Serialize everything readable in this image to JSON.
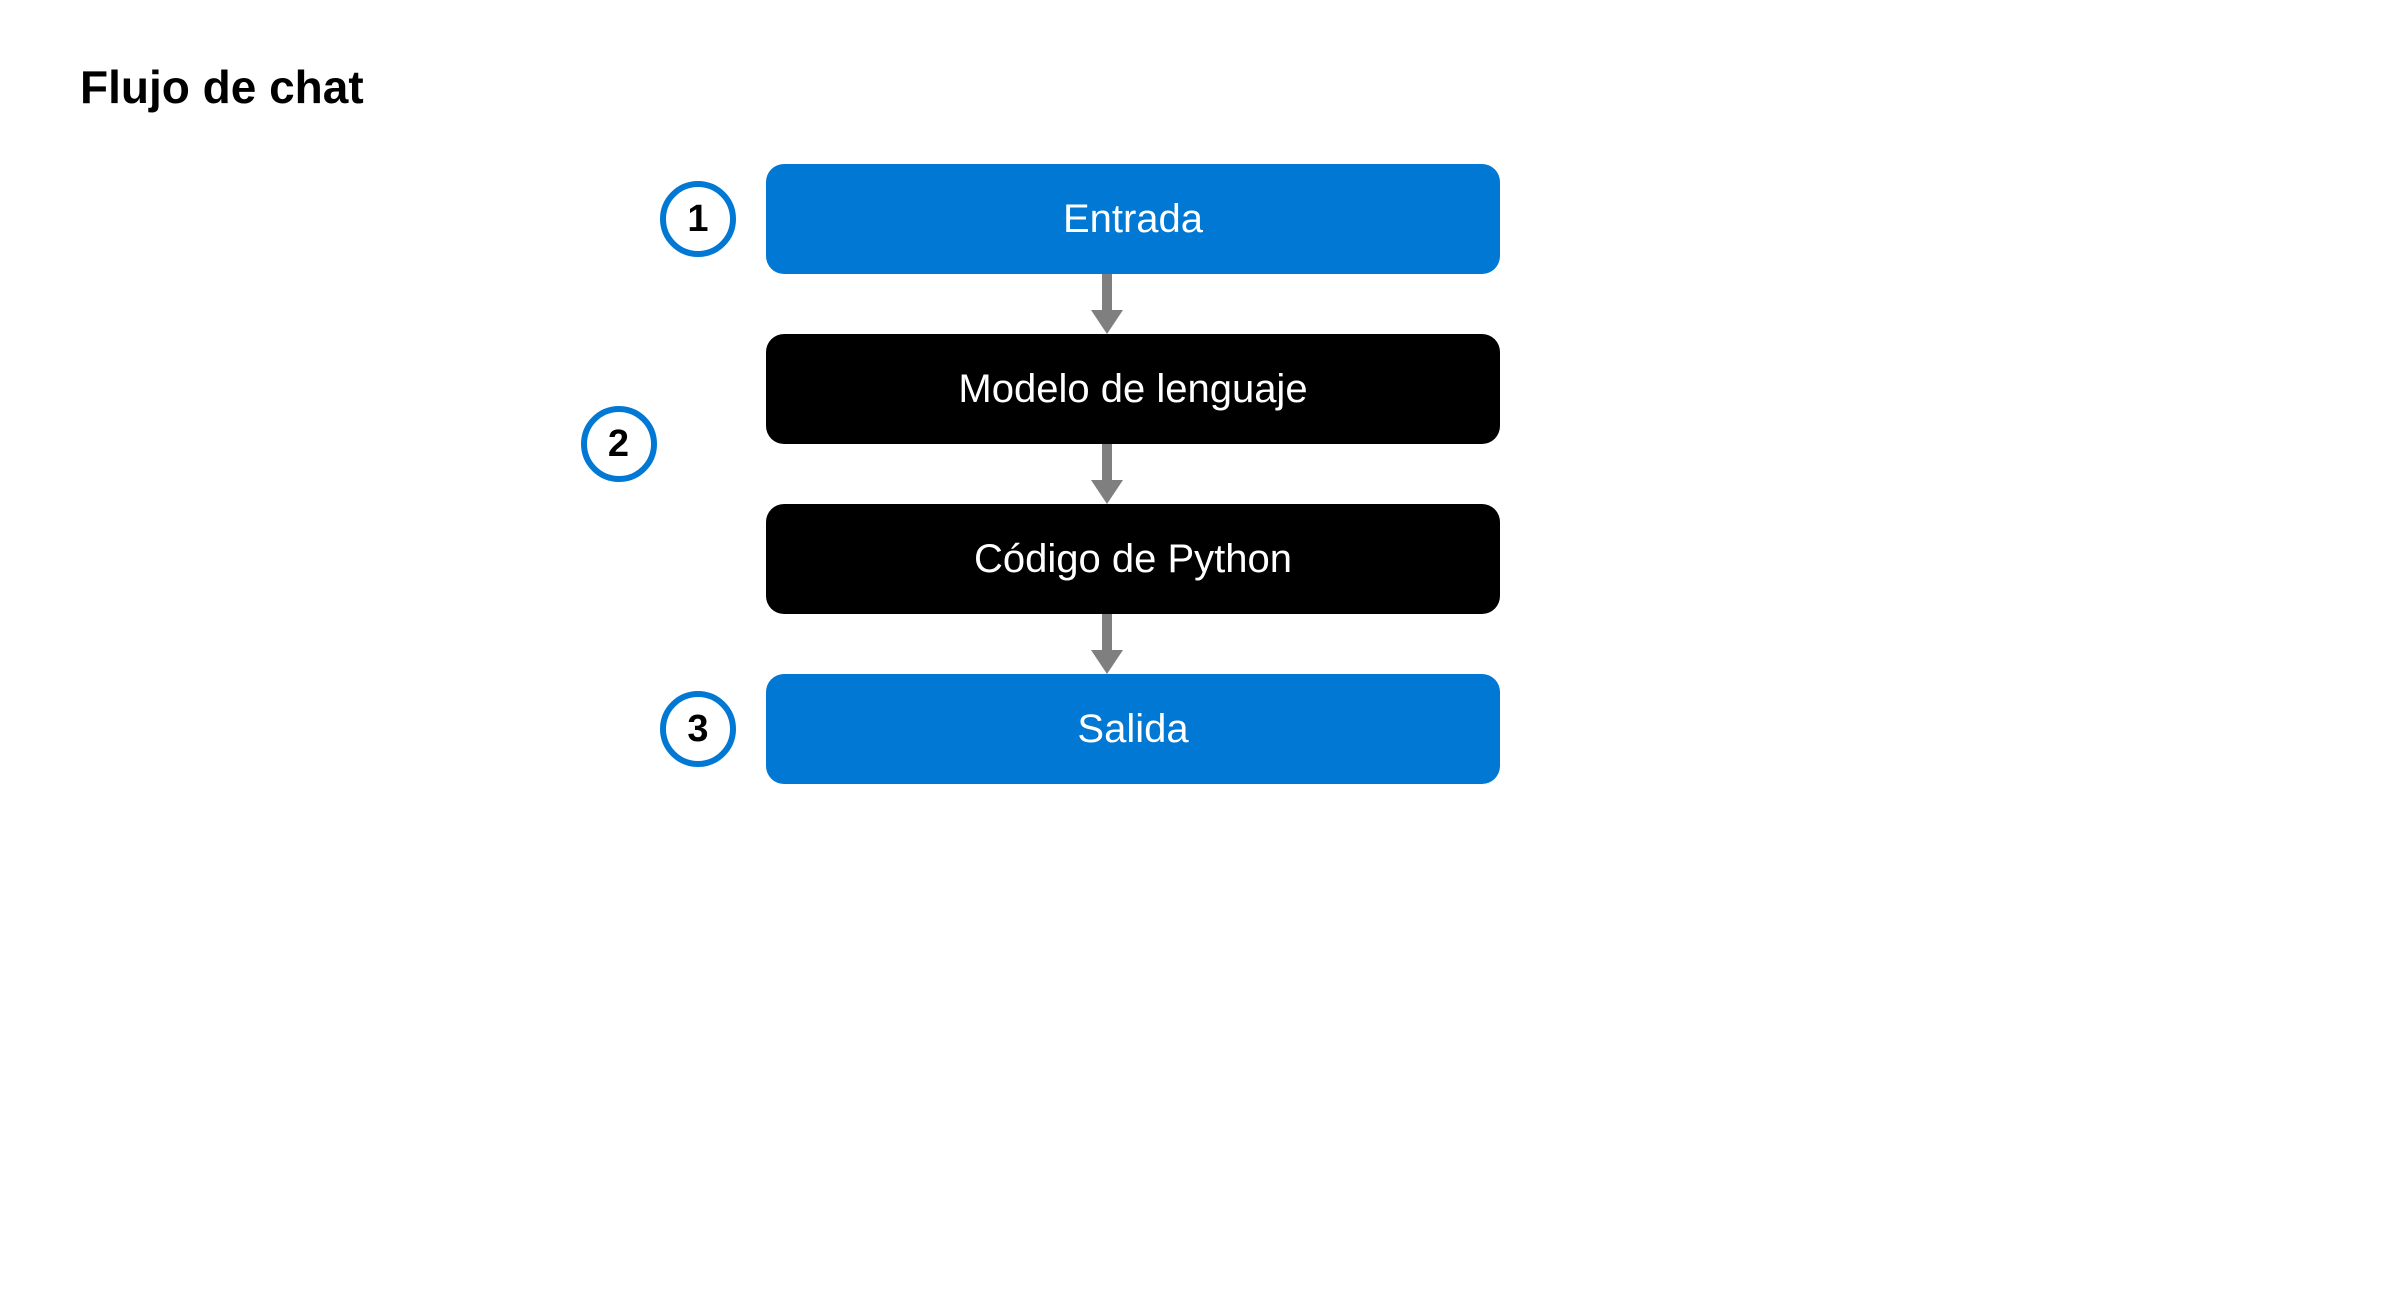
{
  "title": "Flujo de chat",
  "nodes": [
    {
      "number": "1",
      "label": "Entrada",
      "style": "blue"
    },
    {
      "number": null,
      "label": "Modelo de lenguaje",
      "style": "black"
    },
    {
      "number": "2",
      "label": "Código de Python",
      "style": "black",
      "numberPosition": "between"
    },
    {
      "number": "3",
      "label": "Salida",
      "style": "blue"
    }
  ],
  "colors": {
    "accent": "#0078d4",
    "black": "#000000",
    "arrow": "#7f7f7f"
  }
}
